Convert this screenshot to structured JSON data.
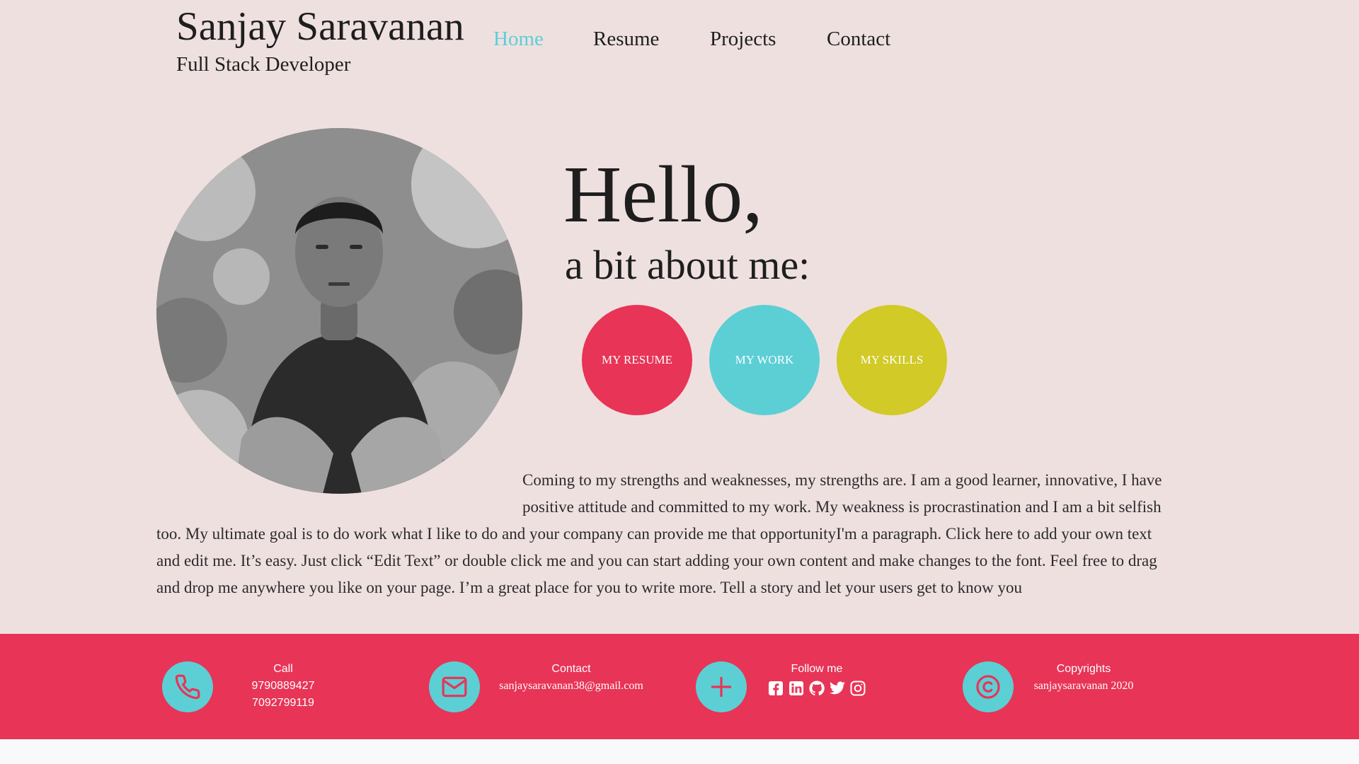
{
  "header": {
    "name": "Sanjay Saravanan",
    "role": "Full Stack Developer",
    "nav": [
      {
        "label": "Home",
        "active": true
      },
      {
        "label": "Resume",
        "active": false
      },
      {
        "label": "Projects",
        "active": false
      },
      {
        "label": "Contact",
        "active": false
      }
    ]
  },
  "hero": {
    "greeting": "Hello,",
    "subheading": "a bit about me:",
    "buttons": [
      {
        "label": "MY RESUME",
        "color": "#e83456"
      },
      {
        "label": "MY WORK",
        "color": "#5ccfd5"
      },
      {
        "label": "MY SKILLS",
        "color": "#d1ca27"
      }
    ],
    "bio_lines": [
      "Coming to my strengths and weaknesses, my strengths are. I am a good learner, innovative, I have",
      "positive attitude and committed to my work. My weakness is procrastination and I am a bit selfish",
      "too. My ultimate goal is to do work what I like to do and your company can provide me that opportunityI'm a paragraph. Click here to add your own text",
      "and edit me. It’s easy. Just click “Edit Text” or double click me and you can start adding your own content and make changes to the font. Feel free to drag",
      "and drop me anywhere you like on your page. I’m a great place for you to write more. Tell a story and let your users get to know you"
    ]
  },
  "footer": {
    "call": {
      "title": "Call",
      "phone1": "9790889427",
      "phone2": "7092799119",
      "icon": "phone-icon"
    },
    "contact": {
      "title": "Contact",
      "email": "sanjaysaravanan38@gmail.com",
      "icon": "mail-icon"
    },
    "follow": {
      "title": "Follow me",
      "icon": "plus-icon",
      "socials": [
        "facebook-icon",
        "linkedin-icon",
        "github-icon",
        "twitter-icon",
        "instagram-icon"
      ]
    },
    "copyright": {
      "title": "Copyrights",
      "text": "sanjaysaravanan 2020",
      "icon": "copyright-icon"
    }
  },
  "colors": {
    "background": "#efe0e0",
    "accent_pink": "#e83456",
    "accent_teal": "#5ccfd5",
    "accent_yellow": "#d1ca27"
  }
}
